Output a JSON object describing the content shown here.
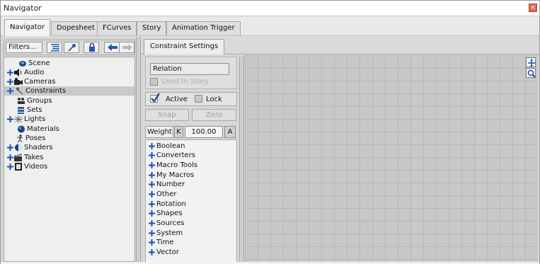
{
  "window": {
    "title": "Navigator",
    "close_icon": "×"
  },
  "tabs": [
    {
      "label": "Navigator",
      "active": true
    },
    {
      "label": "Dopesheet",
      "active": false
    },
    {
      "label": "FCurves",
      "active": false
    },
    {
      "label": "Story",
      "active": false
    },
    {
      "label": "Animation Trigger",
      "active": false
    }
  ],
  "toolbar": {
    "filters_label": "Filters...",
    "icons": [
      "list-view-icon",
      "pin-icon",
      "lock-icon",
      "back-arrow-icon",
      "forward-arrow-icon"
    ]
  },
  "tree": [
    {
      "label": "Scene",
      "icon": "scene-icon",
      "expandable": false,
      "selected": false
    },
    {
      "label": "Audio",
      "icon": "audio-icon",
      "expandable": true,
      "selected": false
    },
    {
      "label": "Cameras",
      "icon": "camera-icon",
      "expandable": true,
      "selected": false
    },
    {
      "label": "Constraints",
      "icon": "constraint-icon",
      "expandable": true,
      "selected": true
    },
    {
      "label": "Groups",
      "icon": "groups-icon",
      "expandable": false,
      "selected": false
    },
    {
      "label": "Sets",
      "icon": "sets-icon",
      "expandable": false,
      "selected": false
    },
    {
      "label": "Lights",
      "icon": "light-icon",
      "expandable": true,
      "selected": false
    },
    {
      "label": "Materials",
      "icon": "material-icon",
      "expandable": false,
      "selected": false
    },
    {
      "label": "Poses",
      "icon": "pose-icon",
      "expandable": false,
      "selected": false
    },
    {
      "label": "Shaders",
      "icon": "shader-icon",
      "expandable": true,
      "selected": false
    },
    {
      "label": "Takes",
      "icon": "takes-icon",
      "expandable": true,
      "selected": false
    },
    {
      "label": "Videos",
      "icon": "video-icon",
      "expandable": true,
      "selected": false
    }
  ],
  "settings": {
    "tab_label": "Constraint Settings",
    "relation_value": "Relation",
    "used_in_story_label": "Used In Story",
    "active_label": "Active",
    "active_checked": true,
    "lock_label": "Lock",
    "lock_checked": false,
    "snap_label": "Snap",
    "zero_label": "Zero",
    "weight_label": "Weight",
    "k_label": "K",
    "weight_value": "100.00",
    "a_label": "A"
  },
  "macros": [
    "Boolean",
    "Converters",
    "Macro Tools",
    "My Macros",
    "Number",
    "Other",
    "Rotation",
    "Shapes",
    "Sources",
    "System",
    "Time",
    "Vector"
  ],
  "colors": {
    "plus_blue": "#1c4fb4",
    "close_red": "#d96a5a"
  }
}
